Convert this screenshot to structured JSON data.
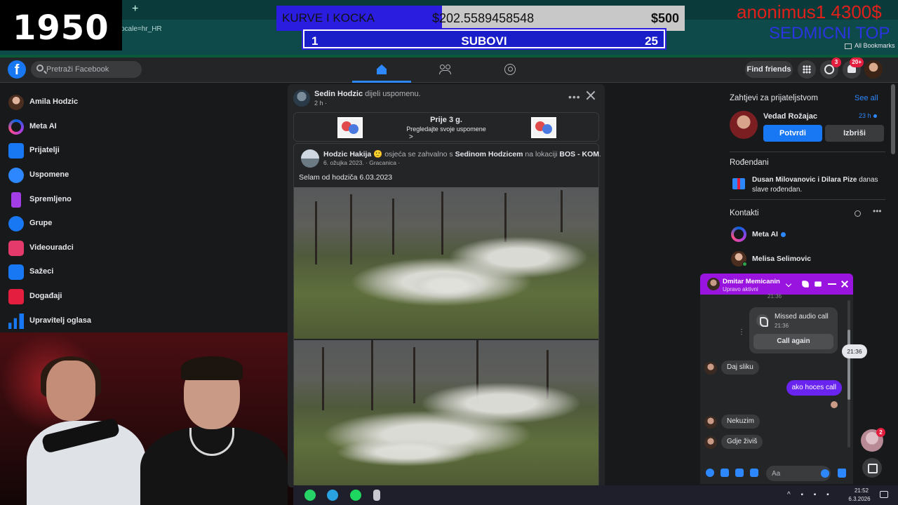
{
  "overlay": {
    "year": "1950",
    "score_name": "KURVE I KOCKA",
    "score_amount": "$202.5589458548",
    "score_prize": "$500",
    "counter_left": "1",
    "counter_label": "SUBOVI",
    "counter_right": "25",
    "donor_name": "anonimus1 4300$",
    "donor_sub": "SEDMICNI TOP"
  },
  "browser": {
    "url_fragment": "ocale=hr_HR",
    "bookmarks_label": "All Bookmarks"
  },
  "topbar": {
    "search_placeholder": "Pretraži Facebook",
    "find_friends": "Find friends",
    "messenger_badge": "3",
    "notifications_badge": "20+"
  },
  "sidebar": {
    "items": [
      {
        "label": "Amila Hodzic",
        "icon": "avatar"
      },
      {
        "label": "Meta AI",
        "icon": "meta-ai-icon"
      },
      {
        "label": "Prijatelji",
        "icon": "friends-icon"
      },
      {
        "label": "Uspomene",
        "icon": "memories-icon"
      },
      {
        "label": "Spremljeno",
        "icon": "bookmark-icon"
      },
      {
        "label": "Grupe",
        "icon": "groups-icon"
      },
      {
        "label": "Videouradci",
        "icon": "video-icon"
      },
      {
        "label": "Sažeci",
        "icon": "reels-icon"
      },
      {
        "label": "Događaji",
        "icon": "events-icon"
      },
      {
        "label": "Upravitelj oglasa",
        "icon": "ads-manager-icon"
      }
    ]
  },
  "post": {
    "author": "Sedin Hodzic",
    "action": "dijeli uspomenu.",
    "time": "2 h ·",
    "memory_title": "Prije 3 g.",
    "memory_sub": "Pregledajte svoje uspomene",
    "shared": {
      "author": "Hodzic Hakija",
      "feeling": "osjeća se zahvalno s",
      "with": "Sedinom Hodzicem",
      "location_prefix": "na lokaciji",
      "location": "BOS - KOM",
      "meta": "6. ožujka 2023. · Gracanica ·",
      "text": "Selam od hodziča 6.03.2023"
    }
  },
  "right": {
    "requests_heading": "Zahtjevi za prijateljstvom",
    "see_all": "See all",
    "request_name": "Vedad Rožajac",
    "request_time": "23 h",
    "confirm": "Potvrdi",
    "delete": "Izbriši",
    "birthdays_heading": "Rođendani",
    "birthday_names": "Dusan Milovanovic i Dilara Pize",
    "birthday_rest": "danas slave rođendan.",
    "contacts_heading": "Kontakti",
    "contacts": [
      "Meta AI",
      "Melisa Selimovic"
    ]
  },
  "chat": {
    "name": "Dmitar Memicanin",
    "status": "Upravo aktivni",
    "top_time": "21:36",
    "missed_title": "Missed audio call",
    "missed_time": "21:36",
    "call_again": "Call again",
    "tooltip_time": "21:36",
    "messages": [
      {
        "dir": "in",
        "text": "Daj sliku"
      },
      {
        "dir": "out",
        "text": "ako hoces call"
      },
      {
        "dir": "in",
        "text": "Nekuzim"
      },
      {
        "dir": "in",
        "text": "Gdje živiš"
      }
    ],
    "input_placeholder": "Aa",
    "float_badge": "2"
  },
  "taskbar": {
    "time": "21:52",
    "date": "6.3.2026"
  }
}
